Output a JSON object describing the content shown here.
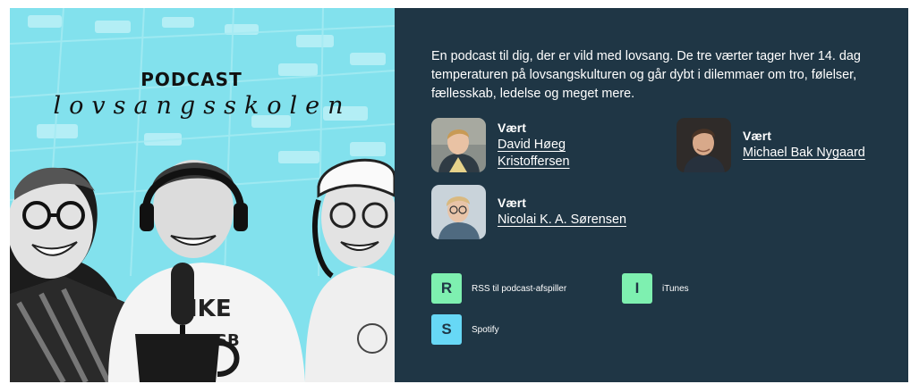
{
  "cover": {
    "podcast_label": "PODCAST",
    "show_name": "lovsangsskolen",
    "background_color": "#7fe0ec"
  },
  "panel": {
    "background_color": "#1f3645",
    "description": "En podcast til dig, der er vild med lovsang. De tre værter tager hver 14. dag temperaturen på lovsangskulturen og går dybt i dilemmaer om tro, følelser, fællesskab, ledelse og meget mere."
  },
  "hosts": [
    {
      "role": "Vært",
      "name": "David Høeg Kristoffersen",
      "avatar_icon": "host-photo"
    },
    {
      "role": "Vært",
      "name": "Michael Bak Nygaard",
      "avatar_icon": "host-photo"
    },
    {
      "role": "Vært",
      "name": "Nicolai K. A. Sørensen",
      "avatar_icon": "host-photo"
    }
  ],
  "subscribe": [
    {
      "letter": "R",
      "label": "RSS til podcast-afspiller",
      "color": "#7ef0b0"
    },
    {
      "letter": "I",
      "label": "iTunes",
      "color": "#7ef0b0"
    },
    {
      "letter": "S",
      "label": "Spotify",
      "color": "#67d8f6"
    }
  ]
}
